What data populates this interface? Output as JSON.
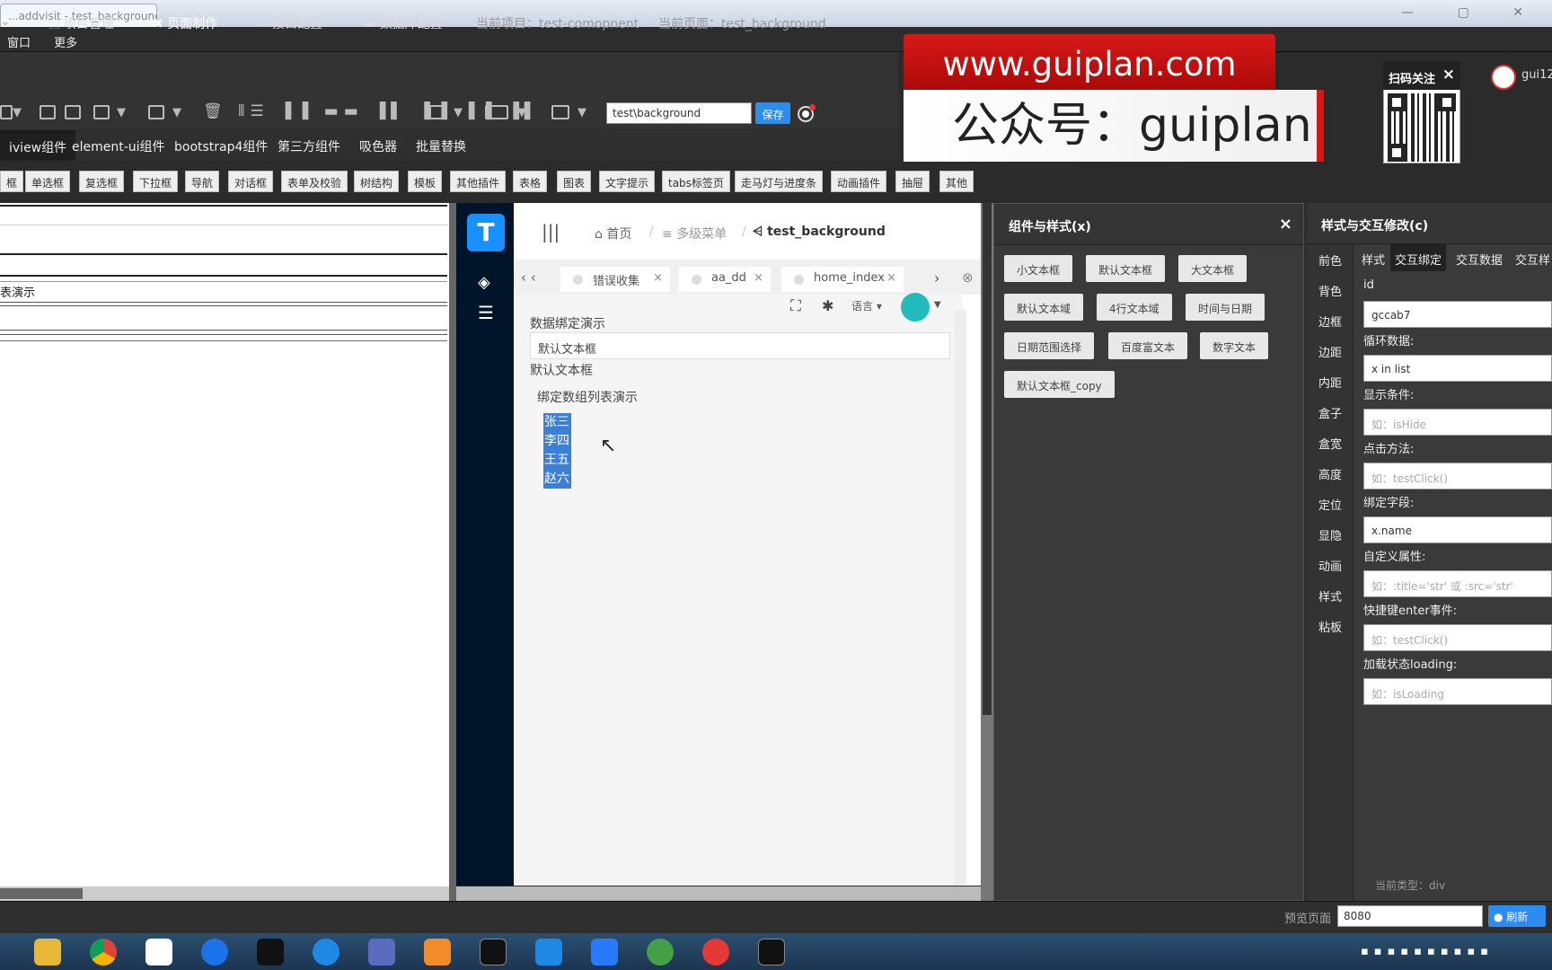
{
  "browser": {
    "tab_title": "...addvisit - test_background...",
    "tab_close": "×"
  },
  "menu": {
    "items": [
      "窗口",
      "更多"
    ]
  },
  "nav": {
    "items": [
      {
        "icon": "file-icon",
        "label": "项目管理"
      },
      {
        "icon": "tools-icon",
        "label": "页面制作"
      },
      {
        "icon": "link-icon",
        "label": "接口配置"
      },
      {
        "icon": "database-icon",
        "label": "数据库配置"
      }
    ],
    "current_project": "当前项目：test-comopnent",
    "current_page": "当前页面：test_background"
  },
  "toolbar": {
    "path_value": "test\\background",
    "save_label": "保存"
  },
  "lib_tabs": [
    "iview组件",
    "element-ui组件",
    "bootstrap4组件",
    "第三方组件",
    "吸色器",
    "批量替换"
  ],
  "chips": [
    "框",
    "单选框",
    "复选框",
    "下拉框",
    "导航",
    "对话框",
    "表单及校验",
    "树结构",
    "模板",
    "其他插件",
    "表格",
    "图表",
    "文字提示",
    "tabs标签页",
    "走马灯与进度条",
    "动画插件",
    "抽屉",
    "其他"
  ],
  "editor": {
    "row_text": "表演示"
  },
  "preview": {
    "logo": "T",
    "breadcrumb": {
      "home": "首页",
      "sep": "/",
      "menu": "多级菜单",
      "current": "test_background"
    },
    "tabs": [
      {
        "label": "错误收集",
        "close": "×"
      },
      {
        "label": "aa_dd",
        "close": "×"
      },
      {
        "label": "home_index",
        "close": "×"
      }
    ],
    "tools": {
      "lang": "语言"
    },
    "content": {
      "title": "数据绑定演示",
      "input_value": "默认文本框",
      "text_below": "默认文本框",
      "list_title": "绑定数组列表演示",
      "list": [
        "张三",
        "李四",
        "王五",
        "赵六"
      ]
    }
  },
  "panel_components": {
    "title": "组件与样式(x)",
    "close": "×",
    "buttons": [
      "小文本框",
      "默认文本框",
      "大文本框",
      "默认文本域",
      "4行文本域",
      "时间与日期",
      "日期范围选择",
      "百度富文本",
      "数字文本",
      "默认文本框_copy"
    ]
  },
  "panel_style": {
    "title": "样式与交互修改(c)",
    "vtabs": [
      "前色",
      "背色",
      "边框",
      "边距",
      "内距",
      "盒子",
      "盒宽",
      "高度",
      "定位",
      "显隐",
      "动画",
      "样式",
      "粘板"
    ],
    "htabs": [
      "样式",
      "交互绑定",
      "交互数据",
      "交互样"
    ],
    "fields": [
      {
        "label": "id",
        "value": "gccab7",
        "placeholder": ""
      },
      {
        "label": "循环数据:",
        "value": "x in list",
        "placeholder": ""
      },
      {
        "label": "显示条件:",
        "value": "",
        "placeholder": "如：isHide"
      },
      {
        "label": "点击方法:",
        "value": "",
        "placeholder": "如：testClick()"
      },
      {
        "label": "绑定字段:",
        "value": "x.name",
        "placeholder": ""
      },
      {
        "label": "自定义属性:",
        "value": "",
        "placeholder": "如：:title='str' 或 :src='str'"
      },
      {
        "label": "快捷键enter事件:",
        "value": "",
        "placeholder": "如：testClick()"
      },
      {
        "label": "加载状态loading:",
        "value": "",
        "placeholder": "如：isLoading"
      }
    ],
    "current_type": "当前类型：div"
  },
  "status": {
    "preview_label": "预览页面",
    "port": "8080",
    "refresh": "刷新"
  },
  "watermark": {
    "url": "www.guiplan.com",
    "wechat": "公众号：guiplan",
    "qr_title": "扫码关注",
    "qr_close": "×",
    "user": "gui12"
  },
  "colors": {
    "accent": "#2d8cf0",
    "sidebar": "#001529",
    "selection": "#3b7fd6",
    "brand_red": "#d81818"
  }
}
